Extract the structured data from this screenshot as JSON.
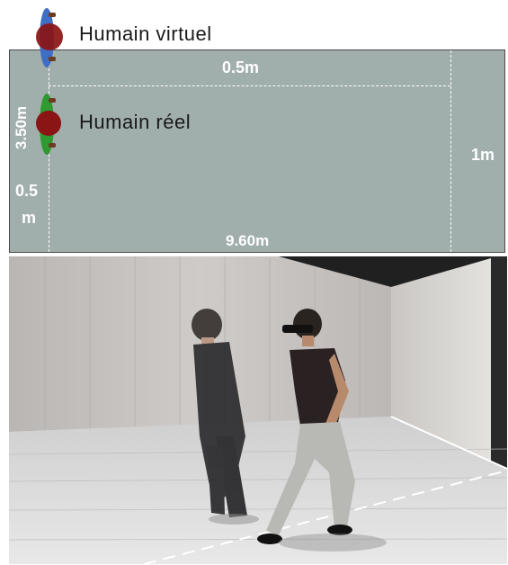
{
  "diagram": {
    "virtual_human_label": "Humain virtuel",
    "real_human_label": "Humain réel",
    "top_zone_label": "0.5m",
    "height_label": "3.50m",
    "left_zone_label_line1": "0.5",
    "left_zone_label_line2": "m",
    "length_label": "9.60m",
    "right_zone_label": "1m",
    "room_color": "#a0aeac",
    "virtual_human_color": "#3f6fc4",
    "real_human_color": "#2f9a2f",
    "head_color": "#8b1414"
  },
  "photo": {
    "description_icons": [
      "virtual-human-figure",
      "real-human-figure",
      "head-mounted-display-icon"
    ]
  }
}
